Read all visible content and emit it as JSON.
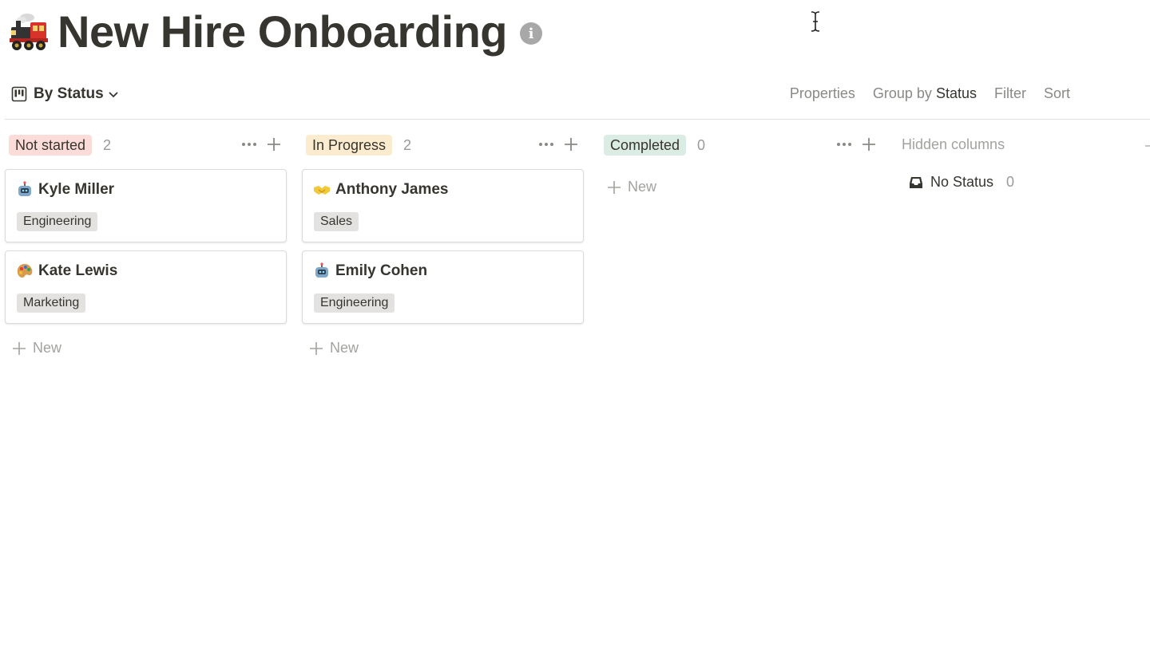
{
  "page": {
    "title": "New Hire Onboarding",
    "title_icon": "train-icon",
    "info_icon": "info-icon"
  },
  "toolbar": {
    "view_label": "By Status",
    "properties_label": "Properties",
    "group_by_label": "Group by",
    "group_by_value": "Status",
    "filter_label": "Filter",
    "sort_label": "Sort"
  },
  "columns": [
    {
      "label": "Not started",
      "count": "2",
      "pill_bg": "#fbdcd8",
      "cards": [
        {
          "name": "Kyle Miller",
          "icon": "robot-icon",
          "tag": "Engineering"
        },
        {
          "name": "Kate Lewis",
          "icon": "palette-icon",
          "tag": "Marketing"
        }
      ],
      "new_label": "New"
    },
    {
      "label": "In Progress",
      "count": "2",
      "pill_bg": "#fbeccf",
      "cards": [
        {
          "name": "Anthony James",
          "icon": "handshake-icon",
          "tag": "Sales"
        },
        {
          "name": "Emily Cohen",
          "icon": "robot-icon",
          "tag": "Engineering"
        }
      ],
      "new_label": "New"
    },
    {
      "label": "Completed",
      "count": "0",
      "pill_bg": "#dbece4",
      "cards": [],
      "new_label": "New"
    }
  ],
  "hidden": {
    "label": "Hidden columns",
    "items": [
      {
        "label": "No Status",
        "count": "0",
        "icon": "inbox-tray-icon"
      }
    ]
  },
  "colors": {
    "text": "#37352f",
    "muted": "#a3a29e",
    "tag_bg": "#e3e2e0",
    "divider": "#e0dfdc"
  }
}
